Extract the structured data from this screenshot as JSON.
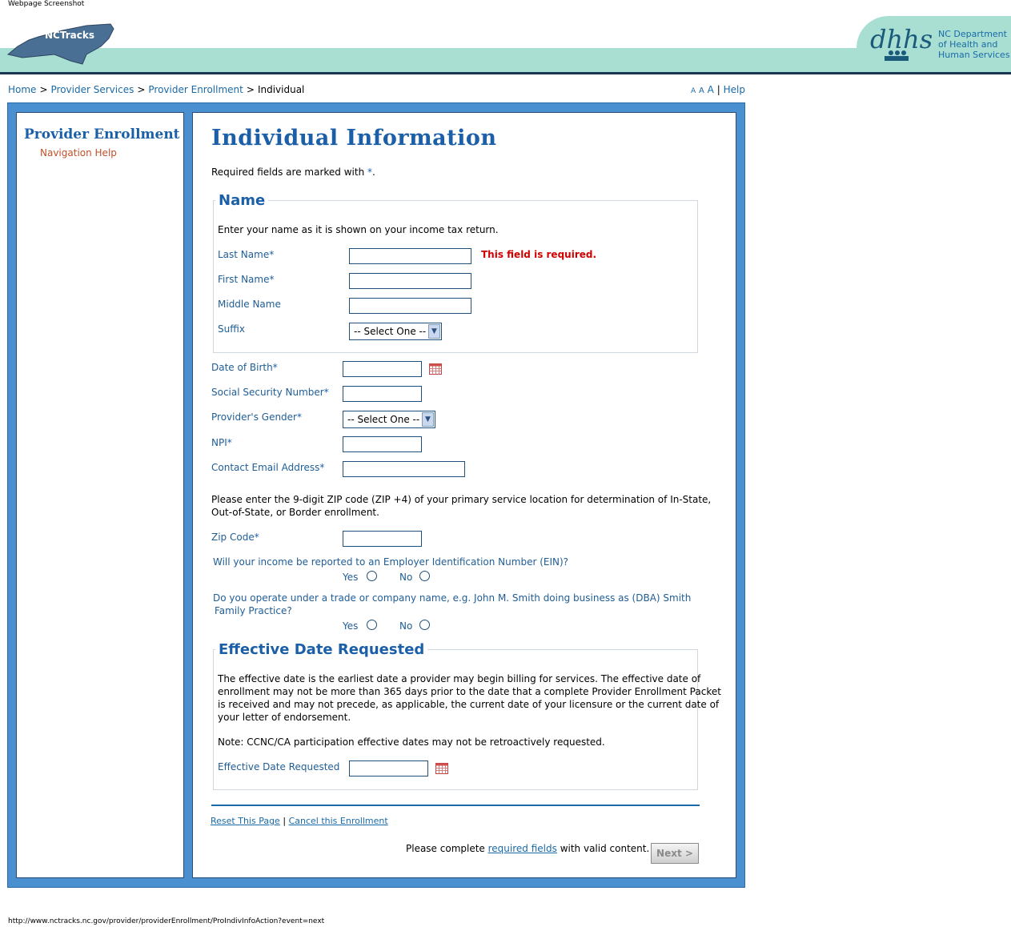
{
  "caption": "Webpage Screenshot",
  "header": {
    "logo_text": "NCTracks",
    "dhhs_lines": [
      "NC Department",
      "of Health and",
      "Human Services"
    ]
  },
  "breadcrumb": {
    "items": [
      "Home",
      "Provider Services",
      "Provider Enrollment"
    ],
    "current": "Individual",
    "separator": ">"
  },
  "utility": {
    "text_sizes": [
      "A",
      "A",
      "A"
    ],
    "separator": "|",
    "help": "Help"
  },
  "sidebar": {
    "title": "Provider Enrollment",
    "nav_help": "Navigation Help"
  },
  "main": {
    "title": "Individual Information",
    "required_note": "Required fields are marked with ",
    "required_star": "*",
    "required_end": "."
  },
  "name_section": {
    "legend": "Name",
    "instruction": "Enter your name as it is shown on your income tax return.",
    "last_name_label": "Last Name",
    "last_name_error": "This field is required.",
    "first_name_label": "First Name",
    "middle_name_label": "Middle Name",
    "suffix_label": "Suffix",
    "suffix_value": "-- Select One --"
  },
  "fields": {
    "star": "*",
    "dob_label": "Date of Birth",
    "ssn_label": "Social Security Number",
    "gender_label": "Provider's Gender",
    "gender_value": "-- Select One --",
    "npi_label": "NPI",
    "email_label": "Contact Email Address",
    "zip_instruction_1": "Please enter the 9-digit ZIP code (ZIP +4) of your primary service location for determination of In-State,",
    "zip_instruction_2": "Out-of-State, or Border enrollment.",
    "zip_label": "Zip Code",
    "ein_question": "Will your income be reported to an Employer Identification Number (EIN)?",
    "dba_question_1": "Do you operate under a trade or company name, e.g. John M. Smith doing business as (DBA) Smith",
    "dba_question_2": "Family Practice?",
    "yes": "Yes",
    "no": "No"
  },
  "effective_section": {
    "legend": "Effective Date Requested",
    "para_1": "The effective date is the earliest date a provider may begin billing for services. The effective date of",
    "para_2": "enrollment may not be more than 365 days prior to the date that a complete Provider Enrollment Packet",
    "para_3": "is received and may not precede, as applicable, the current date of your licensure or the current date of",
    "para_4": "your letter of endorsement.",
    "note": "Note: CCNC/CA participation effective dates may not be retroactively requested.",
    "date_label": "Effective Date Requested"
  },
  "footer": {
    "reset": "Reset This Page",
    "pipe": "|",
    "cancel": "Cancel this Enrollment",
    "complete_pre": "Please complete ",
    "complete_link": "required fields",
    "complete_post": " with valid content.",
    "next": "Next >"
  },
  "url": "http://www.nctracks.nc.gov/provider/providerEnrollment/ProIndivInfoAction?event=next",
  "colors": {
    "accent": "#1a5fa8",
    "frame": "#4a8fd0",
    "header_band": "#a8dfd2",
    "error": "#d00000"
  }
}
